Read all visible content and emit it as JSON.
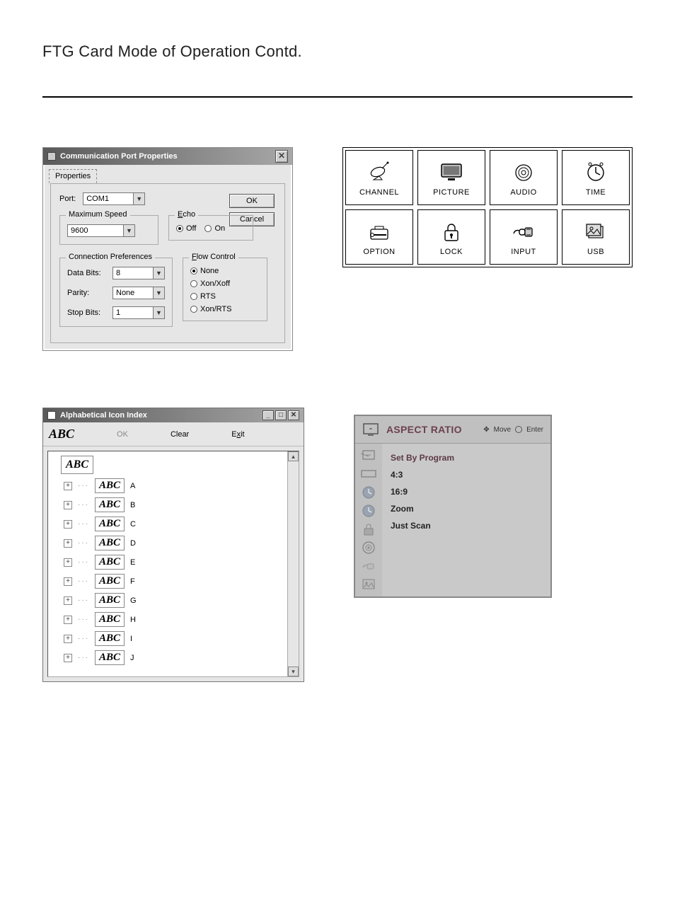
{
  "page": {
    "title": "FTG Card Mode of Operation Contd."
  },
  "commDialog": {
    "title": "Communication Port Properties",
    "tab": "Properties",
    "port_label": "Port:",
    "port_value": "COM1",
    "maxspeed_group": "Maximum Speed",
    "maxspeed_value": "9600",
    "echo_group": "Echo",
    "echo_off": "Off",
    "echo_on": "On",
    "echo_selected": "Off",
    "btn_ok": "OK",
    "btn_cancel": "Cancel",
    "conn_group": "Connection Preferences",
    "databits_label": "Data Bits:",
    "databits_value": "8",
    "parity_label": "Parity:",
    "parity_value": "None",
    "stopbits_label": "Stop Bits:",
    "stopbits_value": "1",
    "flow_group": "Flow Control",
    "flow_none": "None",
    "flow_xon": "Xon/Xoff",
    "flow_rts": "RTS",
    "flow_xonrts": "Xon/RTS",
    "flow_selected": "None"
  },
  "tvgrid": {
    "cells": [
      {
        "label": "CHANNEL",
        "icon": "satellite"
      },
      {
        "label": "PICTURE",
        "icon": "tv"
      },
      {
        "label": "AUDIO",
        "icon": "speaker"
      },
      {
        "label": "TIME",
        "icon": "clock"
      },
      {
        "label": "OPTION",
        "icon": "toolbox"
      },
      {
        "label": "LOCK",
        "icon": "lock"
      },
      {
        "label": "INPUT",
        "icon": "plug"
      },
      {
        "label": "USB",
        "icon": "photo"
      }
    ]
  },
  "idxDialog": {
    "title": "Alphabetical Icon Index",
    "root_label": "ABC",
    "toolbar": {
      "logo": "ABC",
      "ok": "OK",
      "clear": "Clear",
      "exit": "Exit"
    },
    "letters": [
      "A",
      "B",
      "C",
      "D",
      "E",
      "F",
      "G",
      "H",
      "I",
      "J"
    ]
  },
  "osd": {
    "title": "ASPECT RATIO",
    "hint_move": "Move",
    "hint_enter": "Enter",
    "options": [
      "Set By Program",
      "4:3",
      "16:9",
      "Zoom",
      "Just Scan"
    ]
  }
}
